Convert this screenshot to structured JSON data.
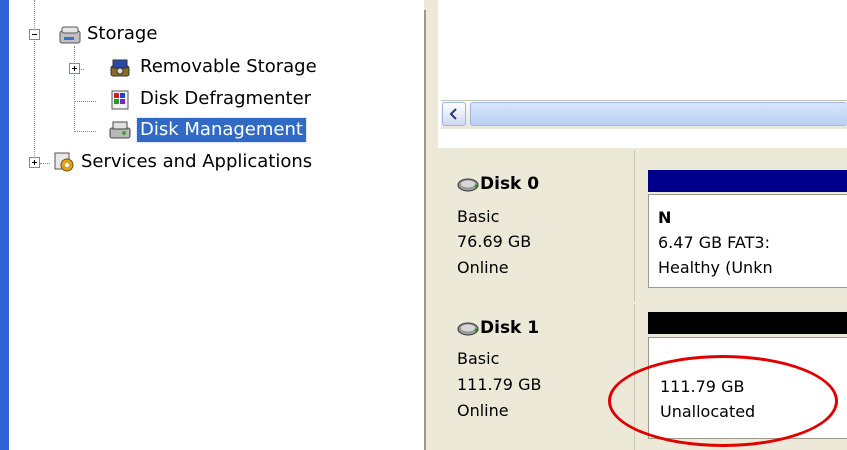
{
  "tree": {
    "items": [
      {
        "label": "Storage"
      },
      {
        "label": "Removable Storage"
      },
      {
        "label": "Disk Defragmenter"
      },
      {
        "label": "Disk Management"
      },
      {
        "label": "Services and Applications"
      }
    ]
  },
  "disks": [
    {
      "name": "Disk 0",
      "type": "Basic",
      "size": "76.69 GB",
      "status": "Online",
      "partition": {
        "letter": "N",
        "detail": "6.47 GB FAT3:",
        "status": "Healthy (Unkn",
        "bar_color": "#00008b"
      }
    },
    {
      "name": "Disk 1",
      "type": "Basic",
      "size": "111.79 GB",
      "status": "Online",
      "partition": {
        "detail": "111.79 GB",
        "status": "Unallocated",
        "bar_color": "#000000"
      }
    }
  ],
  "colors": {
    "selection": "#316ac5",
    "left_strip": "#2f62d4",
    "highlight_ellipse": "#e00000"
  }
}
